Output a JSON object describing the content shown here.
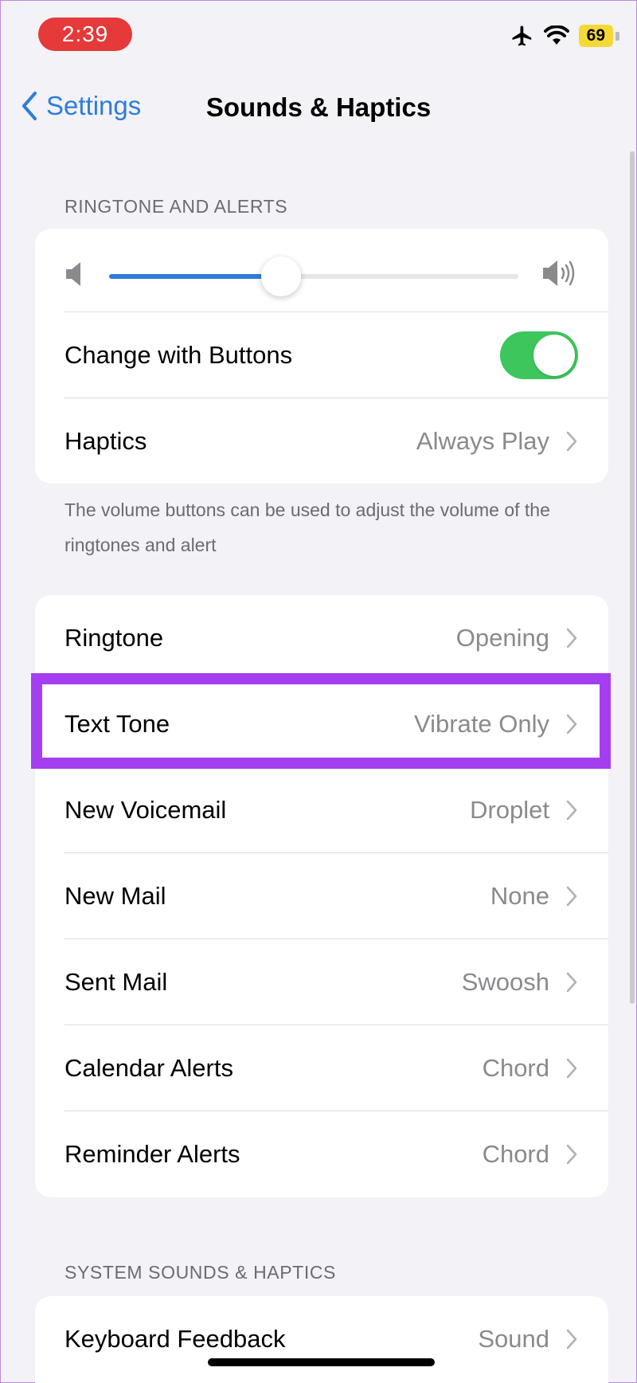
{
  "status_bar": {
    "time": "2:39",
    "battery": "69"
  },
  "nav": {
    "back_label": "Settings",
    "title": "Sounds & Haptics"
  },
  "ringtone_section": {
    "header": "RINGTONE AND ALERTS",
    "volume_level": 0.42,
    "change_with_buttons": {
      "label": "Change with Buttons",
      "on": true
    },
    "haptics": {
      "label": "Haptics",
      "value": "Always Play"
    },
    "footer": "The volume buttons can be used to adjust the volume of the ringtones and alert"
  },
  "tones": [
    {
      "label": "Ringtone",
      "value": "Opening"
    },
    {
      "label": "Text Tone",
      "value": "Vibrate Only"
    },
    {
      "label": "New Voicemail",
      "value": "Droplet"
    },
    {
      "label": "New Mail",
      "value": "None"
    },
    {
      "label": "Sent Mail",
      "value": "Swoosh"
    },
    {
      "label": "Calendar Alerts",
      "value": "Chord"
    },
    {
      "label": "Reminder Alerts",
      "value": "Chord"
    }
  ],
  "system_section": {
    "header": "SYSTEM SOUNDS & HAPTICS",
    "keyboard_feedback": {
      "label": "Keyboard Feedback",
      "value": "Sound"
    }
  },
  "colors": {
    "accent": "#2f7cd9",
    "toggle_on": "#3dc65c",
    "highlight": "#a43ef0",
    "time_pill": "#e5393a"
  }
}
